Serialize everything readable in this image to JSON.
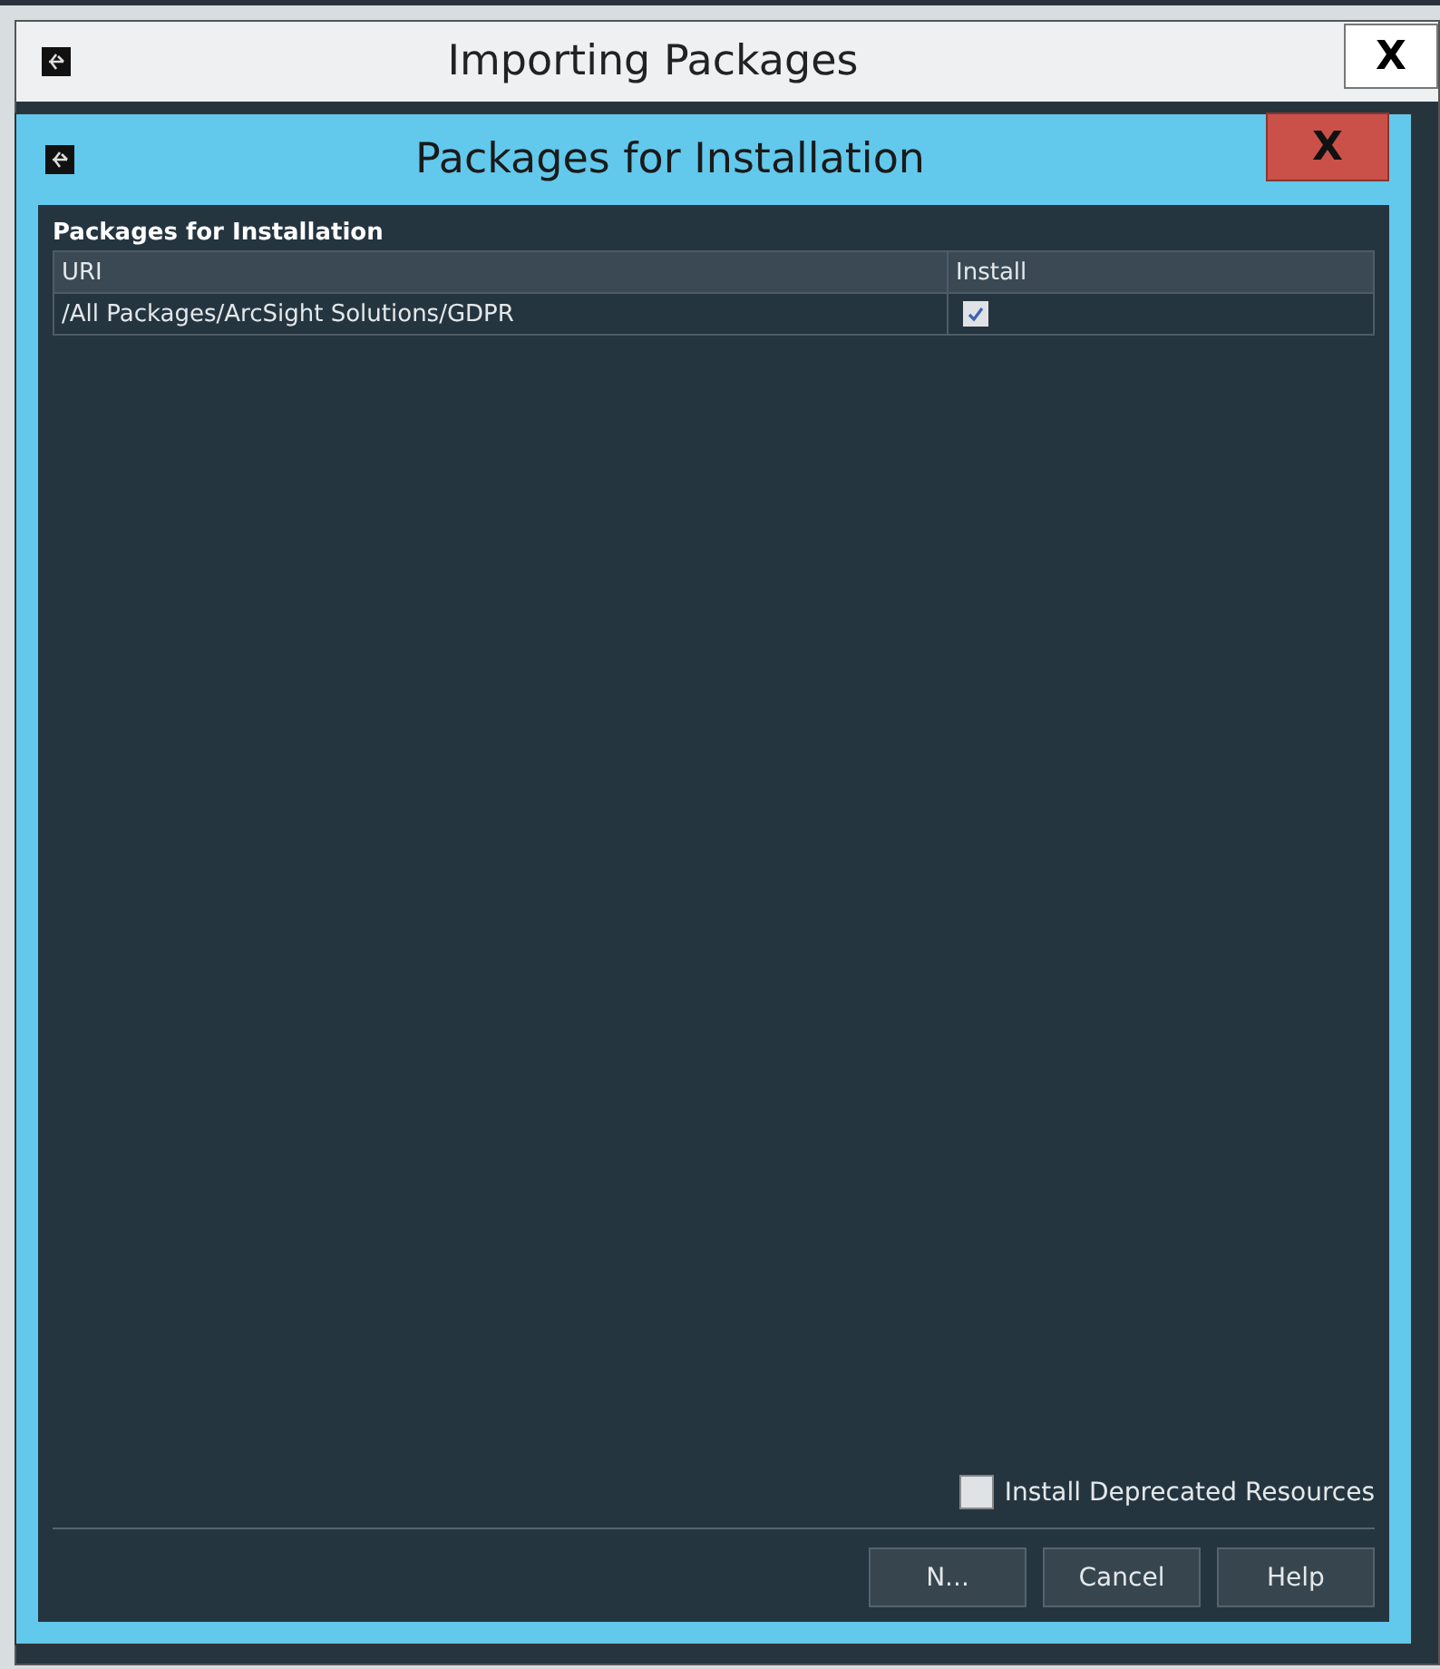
{
  "outer_window": {
    "title": "Importing Packages",
    "close": "X"
  },
  "dialog": {
    "title": "Packages for Installation",
    "close": "X"
  },
  "panel": {
    "title": "Packages for Installation"
  },
  "table": {
    "columns": [
      "URI",
      "Install"
    ],
    "rows": [
      {
        "uri": "/All Packages/ArcSight Solutions/GDPR",
        "checked": true,
        "selected": false
      }
    ]
  },
  "deprecated_option": {
    "label": "Install Deprecated Resources",
    "checked": false
  },
  "buttons": [
    "N...",
    "Cancel",
    "Help"
  ]
}
